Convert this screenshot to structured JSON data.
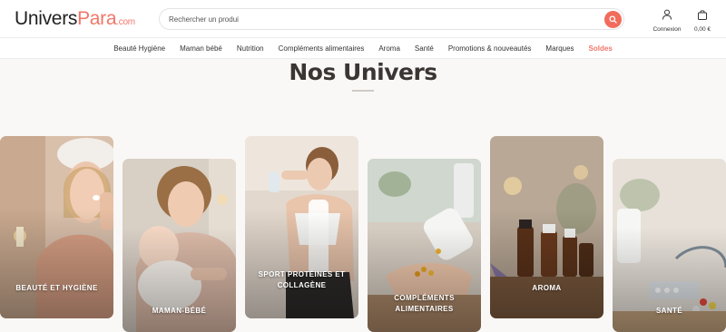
{
  "header": {
    "logo": {
      "part1": "Univers",
      "part2": "Para",
      "part3": ".com"
    },
    "search": {
      "placeholder": "Rechercher un produi"
    },
    "account": {
      "label": "Connexion",
      "icon": "user-icon"
    },
    "cart": {
      "amount": "0,00 €",
      "icon": "shopping-bag-icon"
    }
  },
  "nav": {
    "items": [
      "Beauté Hygiène",
      "Maman bébé",
      "Nutrition",
      "Compléments alimentaires",
      "Aroma",
      "Santé",
      "Promotions & nouveautés",
      "Marques",
      "Soldes"
    ]
  },
  "section": {
    "title": "Nos Univers"
  },
  "cards": [
    {
      "label": "Beauté et hygiène",
      "image": "woman-applying-face-cream"
    },
    {
      "label": "Maman-bébé",
      "image": "mother-holding-baby"
    },
    {
      "label": "Sport protéines et collagène",
      "image": "woman-drinking-water-with-towel"
    },
    {
      "label": "Compléments alimentaires",
      "image": "hand-pouring-capsules-from-bottle"
    },
    {
      "label": "Aroma",
      "image": "essential-oil-bottles"
    },
    {
      "label": "Santé",
      "image": "medicine-pills-and-stethoscope"
    }
  ],
  "colors": {
    "accent": "#f26b5b",
    "title": "#3b3633",
    "background": "#faf8f6"
  }
}
